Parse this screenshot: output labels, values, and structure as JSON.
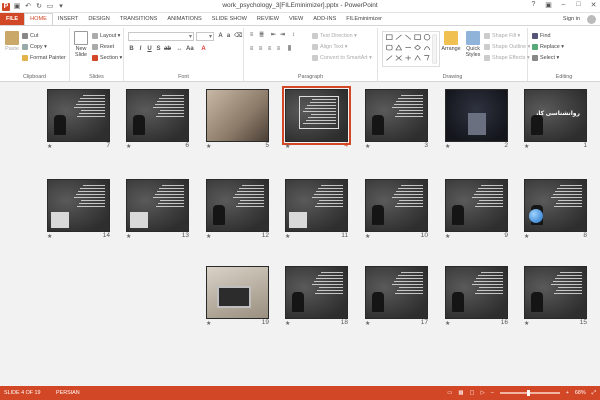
{
  "window": {
    "title": "work_psychology_3[FILEminimizer].pptx - PowerPoint",
    "sign_in": "Sign in"
  },
  "ribbon_tabs": [
    {
      "label": "FILE",
      "id": "file"
    },
    {
      "label": "HOME",
      "id": "home",
      "active": true
    },
    {
      "label": "INSERT",
      "id": "insert"
    },
    {
      "label": "DESIGN",
      "id": "design"
    },
    {
      "label": "TRANSITIONS",
      "id": "transitions"
    },
    {
      "label": "ANIMATIONS",
      "id": "animations"
    },
    {
      "label": "SLIDE SHOW",
      "id": "slide-show"
    },
    {
      "label": "REVIEW",
      "id": "review"
    },
    {
      "label": "VIEW",
      "id": "view"
    },
    {
      "label": "ADD-INS",
      "id": "add-ins"
    },
    {
      "label": "FILEminimizer",
      "id": "fileminimizer"
    }
  ],
  "ribbon": {
    "clipboard": {
      "label": "Clipboard",
      "paste": "Paste",
      "cut": "Cut",
      "copy": "Copy",
      "format_painter": "Format Painter"
    },
    "slides": {
      "label": "Slides",
      "new_slide": "New",
      "new_slide_2": "Slide",
      "layout": "Layout",
      "reset": "Reset",
      "section": "Section"
    },
    "font": {
      "label": "Font"
    },
    "paragraph": {
      "label": "Paragraph",
      "text_direction": "Text Direction",
      "align_text": "Align Text",
      "convert": "Convert to SmartArt"
    },
    "drawing": {
      "label": "Drawing",
      "arrange": "Arrange",
      "quick_styles": "Quick",
      "quick_styles_2": "Styles",
      "shape_fill": "Shape Fill",
      "shape_outline": "Shape Outline",
      "shape_effects": "Shape Effects"
    },
    "editing": {
      "label": "Editing",
      "find": "Find",
      "replace": "Replace",
      "select": "Select"
    }
  },
  "slides": [
    {
      "number": "1",
      "title": "روانشناسی کار",
      "style": "title"
    },
    {
      "number": "2",
      "style": "dark"
    },
    {
      "number": "3",
      "style": "text"
    },
    {
      "number": "4",
      "style": "boxed",
      "selected": true
    },
    {
      "number": "5",
      "style": "photo"
    },
    {
      "number": "6",
      "style": "text-figure"
    },
    {
      "number": "7",
      "style": "text"
    },
    {
      "number": "8",
      "style": "globe"
    },
    {
      "number": "9",
      "style": "text-figure"
    },
    {
      "number": "10",
      "style": "text"
    },
    {
      "number": "11",
      "style": "text-pic"
    },
    {
      "number": "12",
      "style": "text"
    },
    {
      "number": "13",
      "style": "text-pic"
    },
    {
      "number": "14",
      "style": "text-pic"
    },
    {
      "number": "15",
      "style": "text-figure"
    },
    {
      "number": "16",
      "style": "text"
    },
    {
      "number": "17",
      "style": "text"
    },
    {
      "number": "18",
      "style": "text"
    },
    {
      "number": "19",
      "style": "laptop"
    }
  ],
  "transition_marker": "★",
  "status": {
    "slide_indicator": "SLIDE 4 OF 19",
    "language": "PERSIAN",
    "zoom": "68%",
    "zoom_fraction": 0.68
  },
  "colors": {
    "accent": "#d24726"
  }
}
